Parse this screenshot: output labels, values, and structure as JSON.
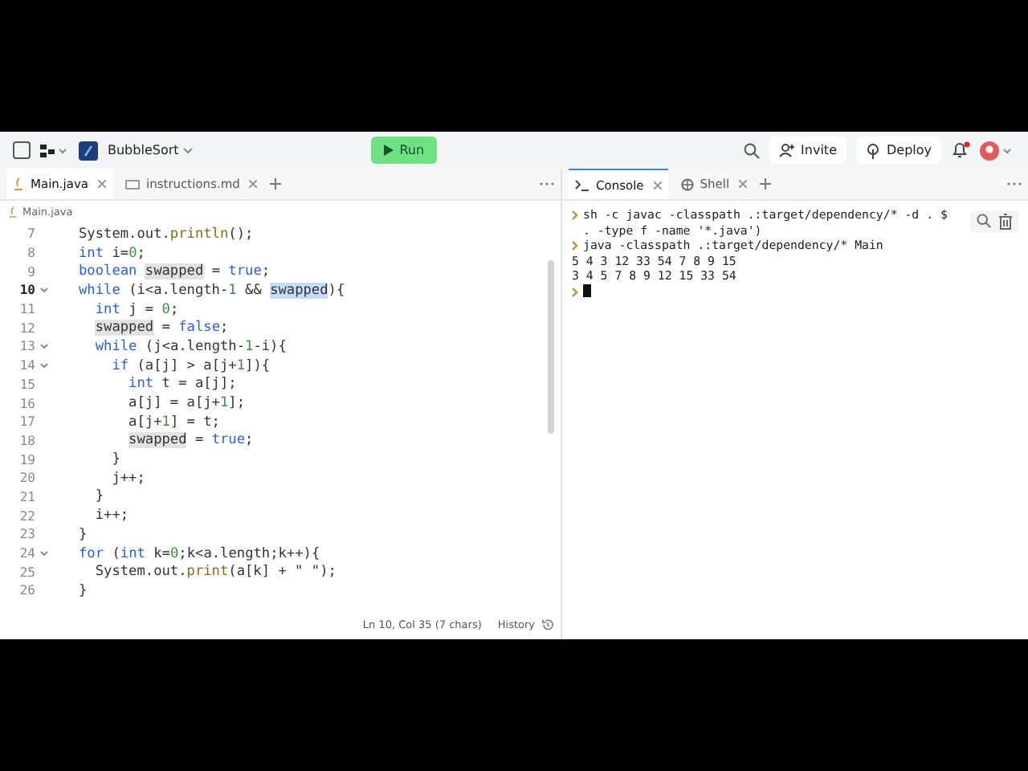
{
  "project": {
    "name": "BubbleSort"
  },
  "run_button": {
    "label": "Run"
  },
  "header_actions": [
    {
      "kind": "invite",
      "label": "Invite"
    },
    {
      "kind": "deploy",
      "label": "Deploy"
    }
  ],
  "notifications": {
    "unread": true
  },
  "editor_tabs": [
    {
      "kind": "java",
      "label": "Main.java",
      "selected": true
    },
    {
      "kind": "markdown",
      "label": "instructions.md",
      "selected": false
    }
  ],
  "breadcrumb": "Main.java",
  "code_lines": [
    {
      "num": "7",
      "fold": false,
      "current": false,
      "tokens": [
        {
          "text": "System.out.",
          "kind": "plain"
        },
        {
          "text": "println",
          "kind": "function"
        },
        {
          "text": "();",
          "kind": "plain"
        }
      ]
    },
    {
      "num": "8",
      "fold": false,
      "current": false,
      "tokens": [
        {
          "text": "int",
          "kind": "keyword"
        },
        {
          "text": " i=",
          "kind": "plain"
        },
        {
          "text": "0",
          "kind": "number"
        },
        {
          "text": ";",
          "kind": "plain"
        }
      ]
    },
    {
      "num": "9",
      "fold": false,
      "current": false,
      "tokens": [
        {
          "text": "boolean ",
          "kind": "keyword"
        },
        {
          "text": "swapped",
          "kind": "occurrence"
        },
        {
          "text": " = ",
          "kind": "plain"
        },
        {
          "text": "true",
          "kind": "keyword"
        },
        {
          "text": ";",
          "kind": "plain"
        }
      ]
    },
    {
      "num": "10",
      "fold": true,
      "current": true,
      "tokens": [
        {
          "text": "while",
          "kind": "keyword"
        },
        {
          "text": " (i<a.length-",
          "kind": "plain"
        },
        {
          "text": "1",
          "kind": "number"
        },
        {
          "text": " && ",
          "kind": "plain"
        },
        {
          "text": "swapped",
          "kind": "selection"
        },
        {
          "text": "){",
          "kind": "plain"
        }
      ]
    },
    {
      "num": "11",
      "fold": false,
      "current": false,
      "tokens": [
        {
          "text": "  int",
          "kind": "keyword"
        },
        {
          "text": " j = ",
          "kind": "plain"
        },
        {
          "text": "0",
          "kind": "number"
        },
        {
          "text": ";",
          "kind": "plain"
        }
      ]
    },
    {
      "num": "12",
      "fold": false,
      "current": false,
      "tokens": [
        {
          "text": "  swapped",
          "kind": "occurrence"
        },
        {
          "text": " = ",
          "kind": "plain"
        },
        {
          "text": "false",
          "kind": "keyword"
        },
        {
          "text": ";",
          "kind": "plain"
        }
      ]
    },
    {
      "num": "13",
      "fold": true,
      "current": false,
      "tokens": [
        {
          "text": "  while",
          "kind": "keyword"
        },
        {
          "text": " (j<a.length-",
          "kind": "plain"
        },
        {
          "text": "1",
          "kind": "number"
        },
        {
          "text": "-i){",
          "kind": "plain"
        }
      ]
    },
    {
      "num": "14",
      "fold": true,
      "current": false,
      "tokens": [
        {
          "text": "    if",
          "kind": "keyword"
        },
        {
          "text": " (a[j] > a[j+",
          "kind": "plain"
        },
        {
          "text": "1",
          "kind": "number"
        },
        {
          "text": "]){",
          "kind": "plain"
        }
      ]
    },
    {
      "num": "15",
      "fold": false,
      "current": false,
      "tokens": [
        {
          "text": "      int",
          "kind": "keyword"
        },
        {
          "text": " t = a[j];",
          "kind": "plain"
        }
      ]
    },
    {
      "num": "16",
      "fold": false,
      "current": false,
      "tokens": [
        {
          "text": "      a[j] = a[j+",
          "kind": "plain"
        },
        {
          "text": "1",
          "kind": "number"
        },
        {
          "text": "];",
          "kind": "plain"
        }
      ]
    },
    {
      "num": "17",
      "fold": false,
      "current": false,
      "tokens": [
        {
          "text": "      a[j+",
          "kind": "plain"
        },
        {
          "text": "1",
          "kind": "number"
        },
        {
          "text": "] = t;",
          "kind": "plain"
        }
      ]
    },
    {
      "num": "18",
      "fold": false,
      "current": false,
      "tokens": [
        {
          "text": "      swapped",
          "kind": "occurrence"
        },
        {
          "text": " = ",
          "kind": "plain"
        },
        {
          "text": "true",
          "kind": "keyword"
        },
        {
          "text": ";",
          "kind": "plain"
        }
      ]
    },
    {
      "num": "19",
      "fold": false,
      "current": false,
      "tokens": [
        {
          "text": "    }",
          "kind": "plain"
        }
      ]
    },
    {
      "num": "20",
      "fold": false,
      "current": false,
      "tokens": [
        {
          "text": "    j++;",
          "kind": "plain"
        }
      ]
    },
    {
      "num": "21",
      "fold": false,
      "current": false,
      "tokens": [
        {
          "text": "  }",
          "kind": "plain"
        }
      ]
    },
    {
      "num": "22",
      "fold": false,
      "current": false,
      "tokens": [
        {
          "text": "  i++;",
          "kind": "plain"
        }
      ]
    },
    {
      "num": "23",
      "fold": false,
      "current": false,
      "tokens": [
        {
          "text": "}",
          "kind": "plain"
        }
      ]
    },
    {
      "num": "24",
      "fold": true,
      "current": false,
      "tokens": [
        {
          "text": "for",
          "kind": "keyword"
        },
        {
          "text": " (",
          "kind": "plain"
        },
        {
          "text": "int",
          "kind": "keyword"
        },
        {
          "text": " k=",
          "kind": "plain"
        },
        {
          "text": "0",
          "kind": "number"
        },
        {
          "text": ";k<a.length;k++){",
          "kind": "plain"
        }
      ]
    },
    {
      "num": "25",
      "fold": false,
      "current": false,
      "tokens": [
        {
          "text": "  System.out.",
          "kind": "plain"
        },
        {
          "text": "print",
          "kind": "function"
        },
        {
          "text": "(a[k] + \" \");",
          "kind": "plain"
        }
      ]
    },
    {
      "num": "26",
      "fold": false,
      "current": false,
      "tokens": [
        {
          "text": "}",
          "kind": "plain"
        }
      ]
    }
  ],
  "status_bar": {
    "position": "Ln 10, Col 35 (7 chars)",
    "history": "History"
  },
  "console_tabs": [
    {
      "kind": "console",
      "label": "Console",
      "selected": true
    },
    {
      "kind": "shell",
      "label": "Shell",
      "selected": false
    }
  ],
  "console_lines": [
    {
      "kind": "cmd",
      "text": "sh -c javac -classpath .:target/dependency/* -d . $\n. -type f -name '*.java')"
    },
    {
      "kind": "cmd",
      "text": "java -classpath .:target/dependency/* Main"
    },
    {
      "kind": "out",
      "text": "5 4 3 12 33 54 7 8 9 15"
    },
    {
      "kind": "out",
      "text": "3 4 5 7 8 9 12 15 33 54"
    },
    {
      "kind": "input"
    }
  ]
}
